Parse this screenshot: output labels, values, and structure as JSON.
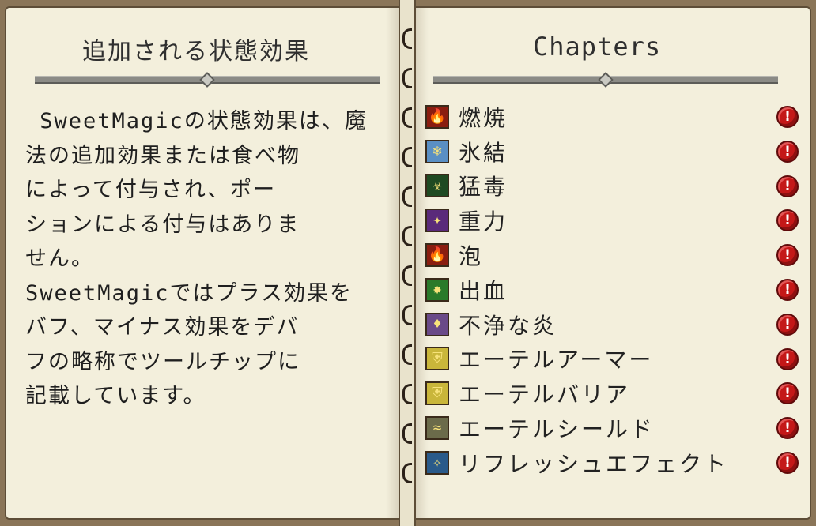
{
  "left_page": {
    "title": "追加される状態効果",
    "body": " SweetMagicの状態効果は、魔\n法の追加効果または食べ物\nによって付与され、ポー\nションによる付与はありま\nせん。\nSweetMagicではプラス効果を\nバフ、マイナス効果をデバ\nフの略称でツールチップに\n記載しています。"
  },
  "right_page": {
    "title": "Chapters",
    "alert_glyph": "!",
    "chapters": [
      {
        "label": "燃焼",
        "icon": "fire-icon",
        "color": "#8a1d10",
        "glyph": "🔥"
      },
      {
        "label": "氷結",
        "icon": "ice-icon",
        "color": "#5a8fc4",
        "glyph": "❄"
      },
      {
        "label": "猛毒",
        "icon": "poison-icon",
        "color": "#1f4a22",
        "glyph": "☣"
      },
      {
        "label": "重力",
        "icon": "gravity-icon",
        "color": "#5a2a7a",
        "glyph": "✦"
      },
      {
        "label": "泡",
        "icon": "fire-bubble-icon",
        "color": "#8a1d10",
        "glyph": "🔥"
      },
      {
        "label": "出血",
        "icon": "bleeding-icon",
        "color": "#2a7a2a",
        "glyph": "✸"
      },
      {
        "label": "不浄な炎",
        "icon": "unholy-flame-icon",
        "color": "#6a4a88",
        "glyph": "♦"
      },
      {
        "label": "エーテルアーマー",
        "icon": "aether-armor-icon",
        "color": "#c9b63a",
        "glyph": "⛨"
      },
      {
        "label": "エーテルバリア",
        "icon": "aether-barrier-icon",
        "color": "#c9b63a",
        "glyph": "⛨"
      },
      {
        "label": "エーテルシールド",
        "icon": "aether-shield-icon",
        "color": "#6b6b4a",
        "glyph": "≈"
      },
      {
        "label": "リフレッシュエフェクト",
        "icon": "refresh-effect-icon",
        "color": "#2a5a8a",
        "glyph": "✧"
      }
    ]
  }
}
